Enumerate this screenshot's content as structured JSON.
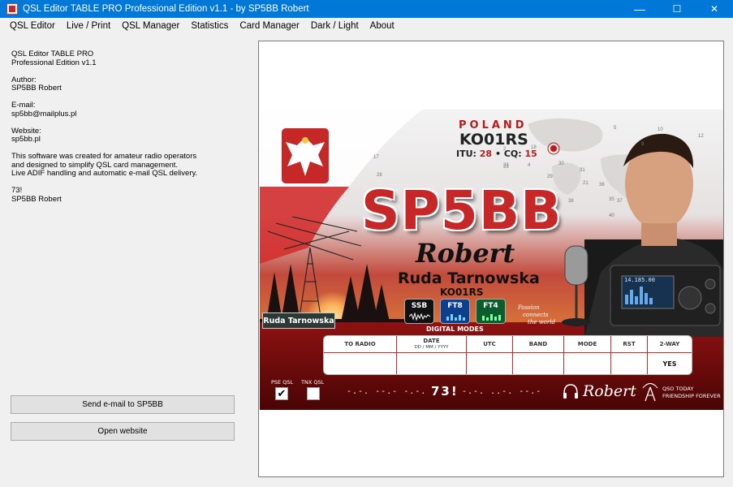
{
  "window": {
    "title": "QSL Editor TABLE PRO Professional Edition v1.1 - by SP5BB Robert",
    "minimize": "—",
    "maximize": "☐",
    "close": "✕"
  },
  "menu": [
    "QSL Editor",
    "Live / Print",
    "QSL Manager",
    "Statistics",
    "Card Manager",
    "Dark / Light",
    "About"
  ],
  "info": {
    "app_line1": "QSL Editor TABLE PRO",
    "app_line2": "Professional Edition v1.1",
    "author_label": "Author:",
    "author": "SP5BB Robert",
    "email_label": "E-mail:",
    "email": "sp5bb@mailplus.pl",
    "website_label": "Website:",
    "website": "sp5bb.pl",
    "desc1": "This software was created for amateur radio operators",
    "desc2": "and designed to simplify QSL card management.",
    "desc3": "Live ADIF handling and automatic e-mail QSL delivery.",
    "greeting": "73!",
    "signature": "SP5BB Robert"
  },
  "buttons": {
    "send_email": "Send e-mail to SP5BB",
    "open_website": "Open website"
  },
  "card": {
    "country": "POLAND",
    "grid": "KO01RS",
    "itu_label": "ITU:",
    "itu": "28",
    "dot": "•",
    "cq_label": "CQ:",
    "cq": "15",
    "callsign": "SP5BB",
    "name": "Robert",
    "city": "Ruda Tarnowska",
    "grid_small": "KO01RS",
    "sign_text": "Ruda Tarnowska",
    "modes": [
      "SSB",
      "FT8",
      "FT4"
    ],
    "modes_label": "DIGITAL MODES",
    "passion": [
      "Passion",
      "connects",
      "the world"
    ],
    "table": {
      "headers": [
        "TO RADIO",
        "DATE",
        "UTC",
        "BAND",
        "MODE",
        "RST",
        "2-WAY"
      ],
      "date_sub": "DD / MM / YYYY",
      "values": [
        "",
        "",
        "",
        "",
        "",
        "",
        "YES"
      ]
    },
    "pse_qsl": "PSE QSL",
    "tnx_qsl": "TNX QSL",
    "pse_checked": "✔",
    "cw_left": "-.-. --.- -.-.",
    "seventy_three": "73!",
    "cw_right": "-.-. ..-. --.-",
    "signature": "Robert",
    "qso_line1": "QSO TODAY",
    "qso_line2": "FRIENDSHIP FOREVER",
    "map_numbers": [
      "2",
      "4",
      "5",
      "9",
      "10",
      "12",
      "17",
      "18",
      "21",
      "23",
      "26",
      "29",
      "30",
      "31",
      "33",
      "35",
      "36",
      "37",
      "38",
      "40"
    ],
    "radio_display": "14.185.00"
  },
  "colors": {
    "titlebar": "#0078d7",
    "accent_red": "#c62828"
  }
}
